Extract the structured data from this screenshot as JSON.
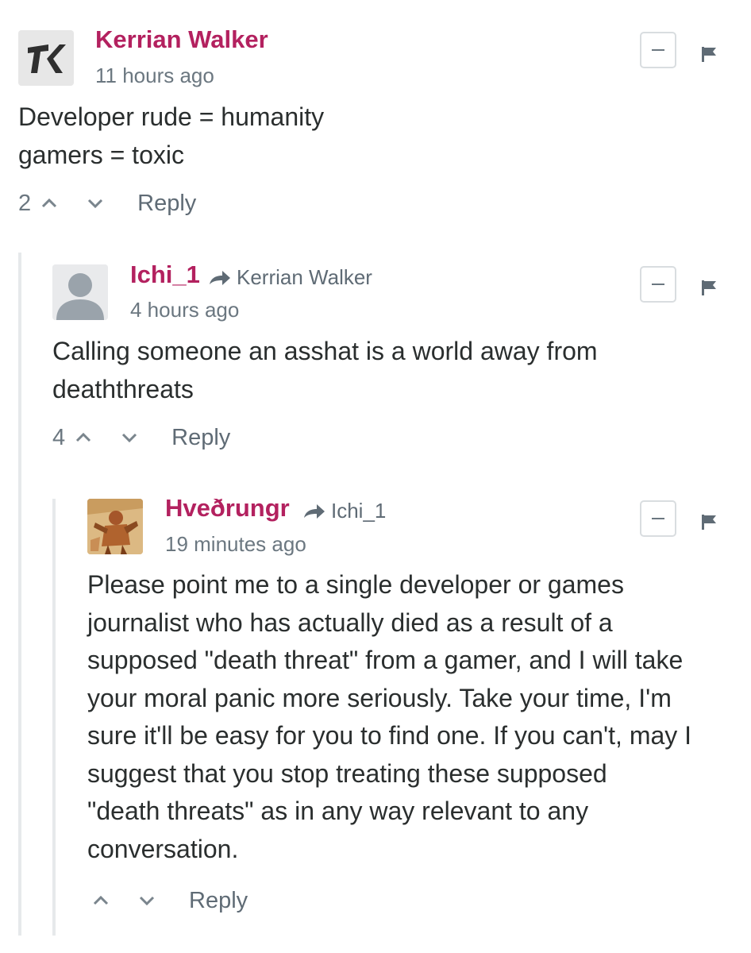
{
  "comments": [
    {
      "author": "Kerrian Walker",
      "timestamp": "11 hours ago",
      "avatar_text": "ꓘ",
      "body": [
        "Developer rude = humanity",
        "gamers = toxic"
      ],
      "votes": "2",
      "reply_label": "Reply"
    },
    {
      "author": "Ichi_1",
      "reply_to": "Kerrian Walker",
      "timestamp": "4 hours ago",
      "body": [
        "Calling someone an asshat is a world away from",
        "deaththreats"
      ],
      "votes": "4",
      "reply_label": "Reply"
    },
    {
      "author": "Hveðrungr",
      "reply_to": "Ichi_1",
      "timestamp": "19 minutes ago",
      "body": [
        "Please point me to a single developer or games",
        "journalist who has actually died as a result of a",
        "supposed \"death threat\" from a gamer, and I will take",
        "your moral panic more seriously. Take your time, I'm",
        "sure it'll be easy for you to find one. If you can't, may I",
        "suggest that you stop treating these supposed",
        "\"death threats\" as in any way relevant to any",
        "conversation."
      ],
      "votes": "",
      "reply_label": "Reply"
    }
  ],
  "colors": {
    "author": "#b3215f",
    "muted": "#6b7780",
    "text": "#2a2e2e",
    "thread_line": "#e6e9eb"
  },
  "icons": {
    "upvote": "chevron-up-icon",
    "downvote": "chevron-down-icon",
    "flag": "flag-icon",
    "collapse": "minus-icon",
    "reply_arrow": "share-arrow-icon"
  }
}
